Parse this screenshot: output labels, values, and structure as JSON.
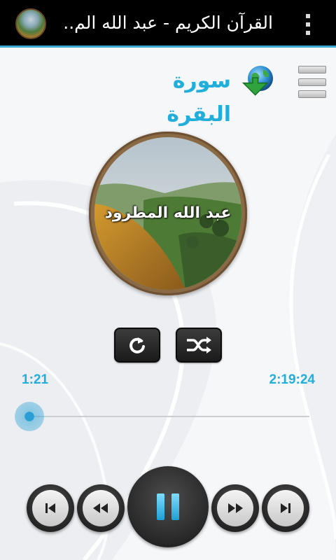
{
  "app": {
    "title": "القرآن الكريم - عبد الله الم...",
    "icon": "app-logo-icon",
    "accent_color": "#3aa7d6"
  },
  "header": {
    "surah_title": "سورة البقرة",
    "download_icon": "globe-download-icon",
    "menu_icon": "list-menu-icon"
  },
  "reciter": {
    "name": "عبد الله المطرود"
  },
  "player": {
    "elapsed": "1:21",
    "total": "2:19:24",
    "progress_fraction": 0.01,
    "repeat_icon": "repeat-icon",
    "shuffle_icon": "shuffle-icon",
    "title_color": "#22aeda"
  }
}
